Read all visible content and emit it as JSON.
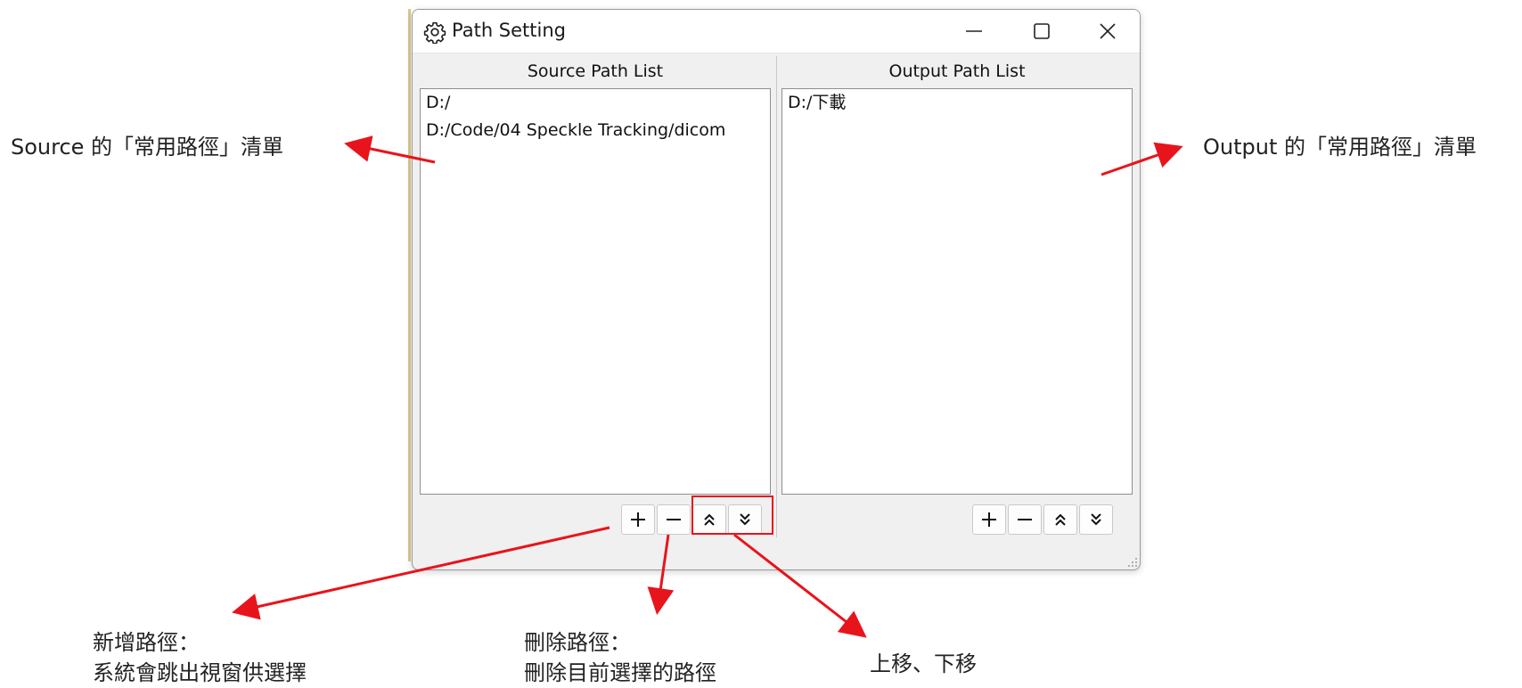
{
  "window": {
    "title": "Path Setting",
    "icon": "gear-icon",
    "controls": [
      "minimize-icon",
      "maximize-icon",
      "close-icon"
    ]
  },
  "source_panel": {
    "label": "Source Path List",
    "items": [
      "D:/",
      "D:/Code/04 Speckle Tracking/dicom"
    ],
    "buttons": {
      "add": "+",
      "remove": "−",
      "up": "⌃⌃",
      "down": "⌄⌄"
    }
  },
  "output_panel": {
    "label": "Output Path List",
    "items": [
      "D:/下載"
    ],
    "buttons": {
      "add": "+",
      "remove": "−",
      "up": "⌃⌃",
      "down": "⌄⌄"
    }
  },
  "annotations": {
    "source_list": "Source 的「常用路徑」清單",
    "output_list": "Output 的「常用路徑」清單",
    "add_line1": "新增路徑：",
    "add_line2": "系統會跳出視窗供選擇",
    "remove_line1": "刪除路徑：",
    "remove_line2": "刪除目前選擇的路徑",
    "move": "上移、下移"
  },
  "colors": {
    "annotation_arrow": "#e8141b",
    "dialog_bg": "#f0f0f0"
  }
}
